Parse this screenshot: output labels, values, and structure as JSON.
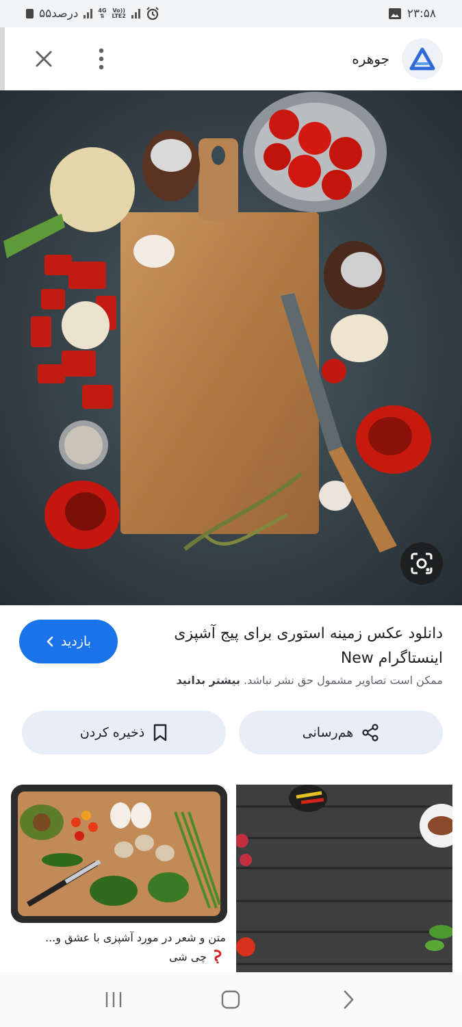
{
  "status_bar": {
    "time": "۲۳:۵۸",
    "battery_text": "۵۵درصد",
    "network_4g": "4G",
    "network_lte": "LTE2",
    "network_vo": "Vo))"
  },
  "app_bar": {
    "site_name": "جوهره"
  },
  "result": {
    "title": "دانلود عکس زمینه استوری برای پیج آشپزی اینستاگرام New",
    "visit_label": "بازدید",
    "copyright_text": "ممکن است تصاویر مشمول حق نشر نباشد.",
    "learn_more": "بیشتر بدانید",
    "share_label": "هم‌رسانی",
    "save_label": "ذخیره کردن"
  },
  "related": [
    {
      "caption": "متن و شعر در مورد آشپزی با عشق و...",
      "source": "چی شی"
    },
    {
      "caption": "",
      "source": ""
    }
  ],
  "colors": {
    "accent": "#1a73e8",
    "pill_bg": "#e8eef8",
    "status_bg": "#f2f3f5"
  },
  "icons": {
    "close": "close-icon",
    "menu": "more-vert-icon",
    "logo": "jowhareh-logo-icon",
    "lens": "lens-camera-icon",
    "share": "share-icon",
    "bookmark": "bookmark-icon",
    "chevron": "chevron-left-icon"
  }
}
